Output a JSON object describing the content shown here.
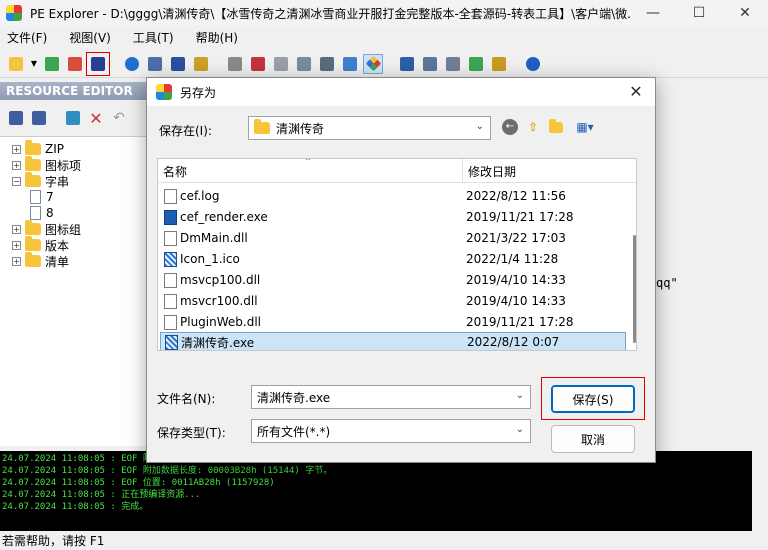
{
  "window": {
    "title": "PE Explorer - D:\\gggg\\清渊传奇\\【冰雪传奇之清渊冰雪商业开服打金完整版本-全套源码-转表工具】\\客户端\\微...",
    "minimize": "—",
    "maximize": "☐",
    "close": "✕"
  },
  "menu": [
    "文件(F)",
    "视图(V)",
    "工具(T)",
    "帮助(H)"
  ],
  "resource_editor": {
    "header": "RESOURCE EDITOR",
    "tree": [
      {
        "label": "ZIP",
        "expander": "+"
      },
      {
        "label": "图标项",
        "expander": "+"
      },
      {
        "label": "字串",
        "expander": "−"
      },
      {
        "label": "7"
      },
      {
        "label": "8"
      },
      {
        "label": "图标组",
        "expander": "+"
      },
      {
        "label": "版本",
        "expander": "+"
      },
      {
        "label": "清单",
        "expander": "+"
      }
    ]
  },
  "right_fragment": "qq\"",
  "console": [
    "24.07.2024 11:08:05 : EOF 附加",
    "24.07.2024 11:08:05 : EOF 附加数据长度: 00003B28h  (15144) 字节。",
    "24.07.2024 11:08:05 : EOF 位置: 0011AB28h  (1157928)",
    "24.07.2024 11:08:05 : 正在预编译资源...",
    "24.07.2024 11:08:05 : 完成。"
  ],
  "status": "若需帮助，请按 F1",
  "dialog": {
    "title": "另存为",
    "close": "✕",
    "save_in_label": "保存在(I):",
    "save_in_value": "清渊传奇",
    "columns": {
      "name": "名称",
      "date": "修改日期"
    },
    "files": [
      {
        "name": "cef.log",
        "date": "2022/8/12 11:56",
        "type": "doc"
      },
      {
        "name": "cef_render.exe",
        "date": "2019/11/21 17:28",
        "type": "exe"
      },
      {
        "name": "DmMain.dll",
        "date": "2021/3/22 17:03",
        "type": "doc"
      },
      {
        "name": "Icon_1.ico",
        "date": "2022/1/4 11:28",
        "type": "ico"
      },
      {
        "name": "msvcp100.dll",
        "date": "2019/4/10 14:33",
        "type": "doc"
      },
      {
        "name": "msvcr100.dll",
        "date": "2019/4/10 14:33",
        "type": "doc"
      },
      {
        "name": "PluginWeb.dll",
        "date": "2019/11/21 17:28",
        "type": "doc"
      },
      {
        "name": "清渊传奇.exe",
        "date": "2022/8/12 0:07",
        "type": "ico",
        "selected": true
      }
    ],
    "filename_label": "文件名(N):",
    "filename_value": "清渊传奇.exe",
    "filetype_label": "保存类型(T):",
    "filetype_value": "所有文件(*.*)",
    "save_button": "保存(S)",
    "cancel_button": "取消"
  },
  "colors": {
    "accent": "#0067c0",
    "highlight": "#dd0000",
    "console_text": "#44e444",
    "selection": "#cce4f7"
  }
}
